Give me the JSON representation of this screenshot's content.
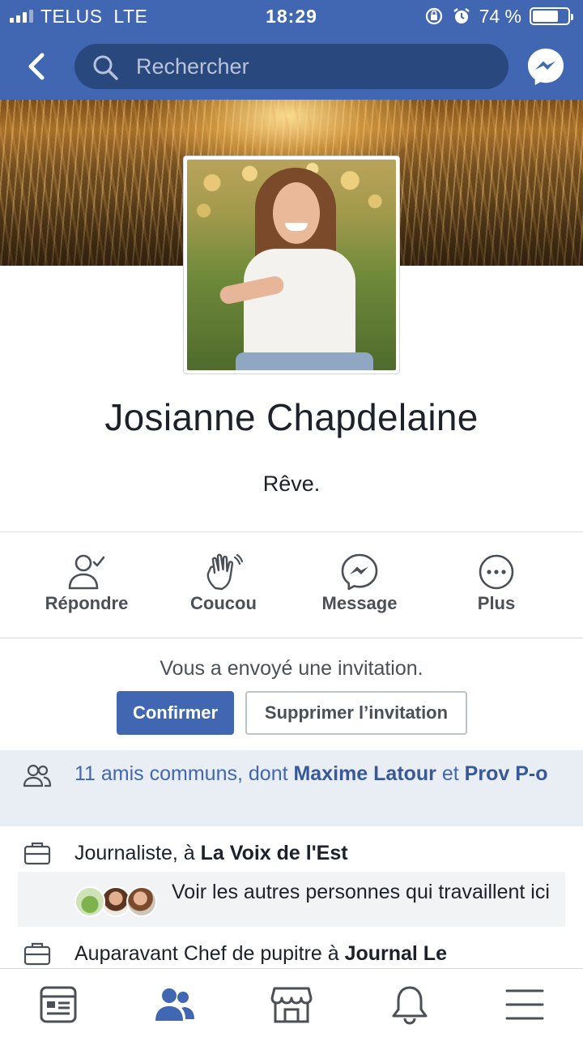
{
  "status_bar": {
    "carrier": "TELUS",
    "network": "LTE",
    "time": "18:29",
    "battery": "74 %",
    "battery_level": 0.74
  },
  "nav": {
    "search_placeholder": "Rechercher"
  },
  "profile": {
    "name": "Josianne Chapdelaine",
    "bio": "Rêve."
  },
  "actions": [
    {
      "label": "Répondre",
      "icon": "respond-icon"
    },
    {
      "label": "Coucou",
      "icon": "wave-icon"
    },
    {
      "label": "Message",
      "icon": "messenger-icon"
    },
    {
      "label": "Plus",
      "icon": "more-icon"
    }
  ],
  "invitation": {
    "text": "Vous a envoyé une invitation.",
    "confirm": "Confirmer",
    "delete": "Supprimer l’invitation"
  },
  "mutual": {
    "prefix": "11 amis communs, dont ",
    "friend1": "Maxime Latour",
    "conj": " et",
    "friend2": "Prov P-o"
  },
  "work": {
    "current_prefix": "Journaliste, à ",
    "current_employer": "La Voix de l'Est",
    "colleagues_text": "Voir les autres personnes qui travaillent ici",
    "previous_prefix": "Auparavant Chef de pupitre à ",
    "previous_employer": "Journal Le"
  },
  "colors": {
    "brand": "#4267b2",
    "search_bg": "#29487d",
    "mutual_bg": "#e9edf4"
  }
}
